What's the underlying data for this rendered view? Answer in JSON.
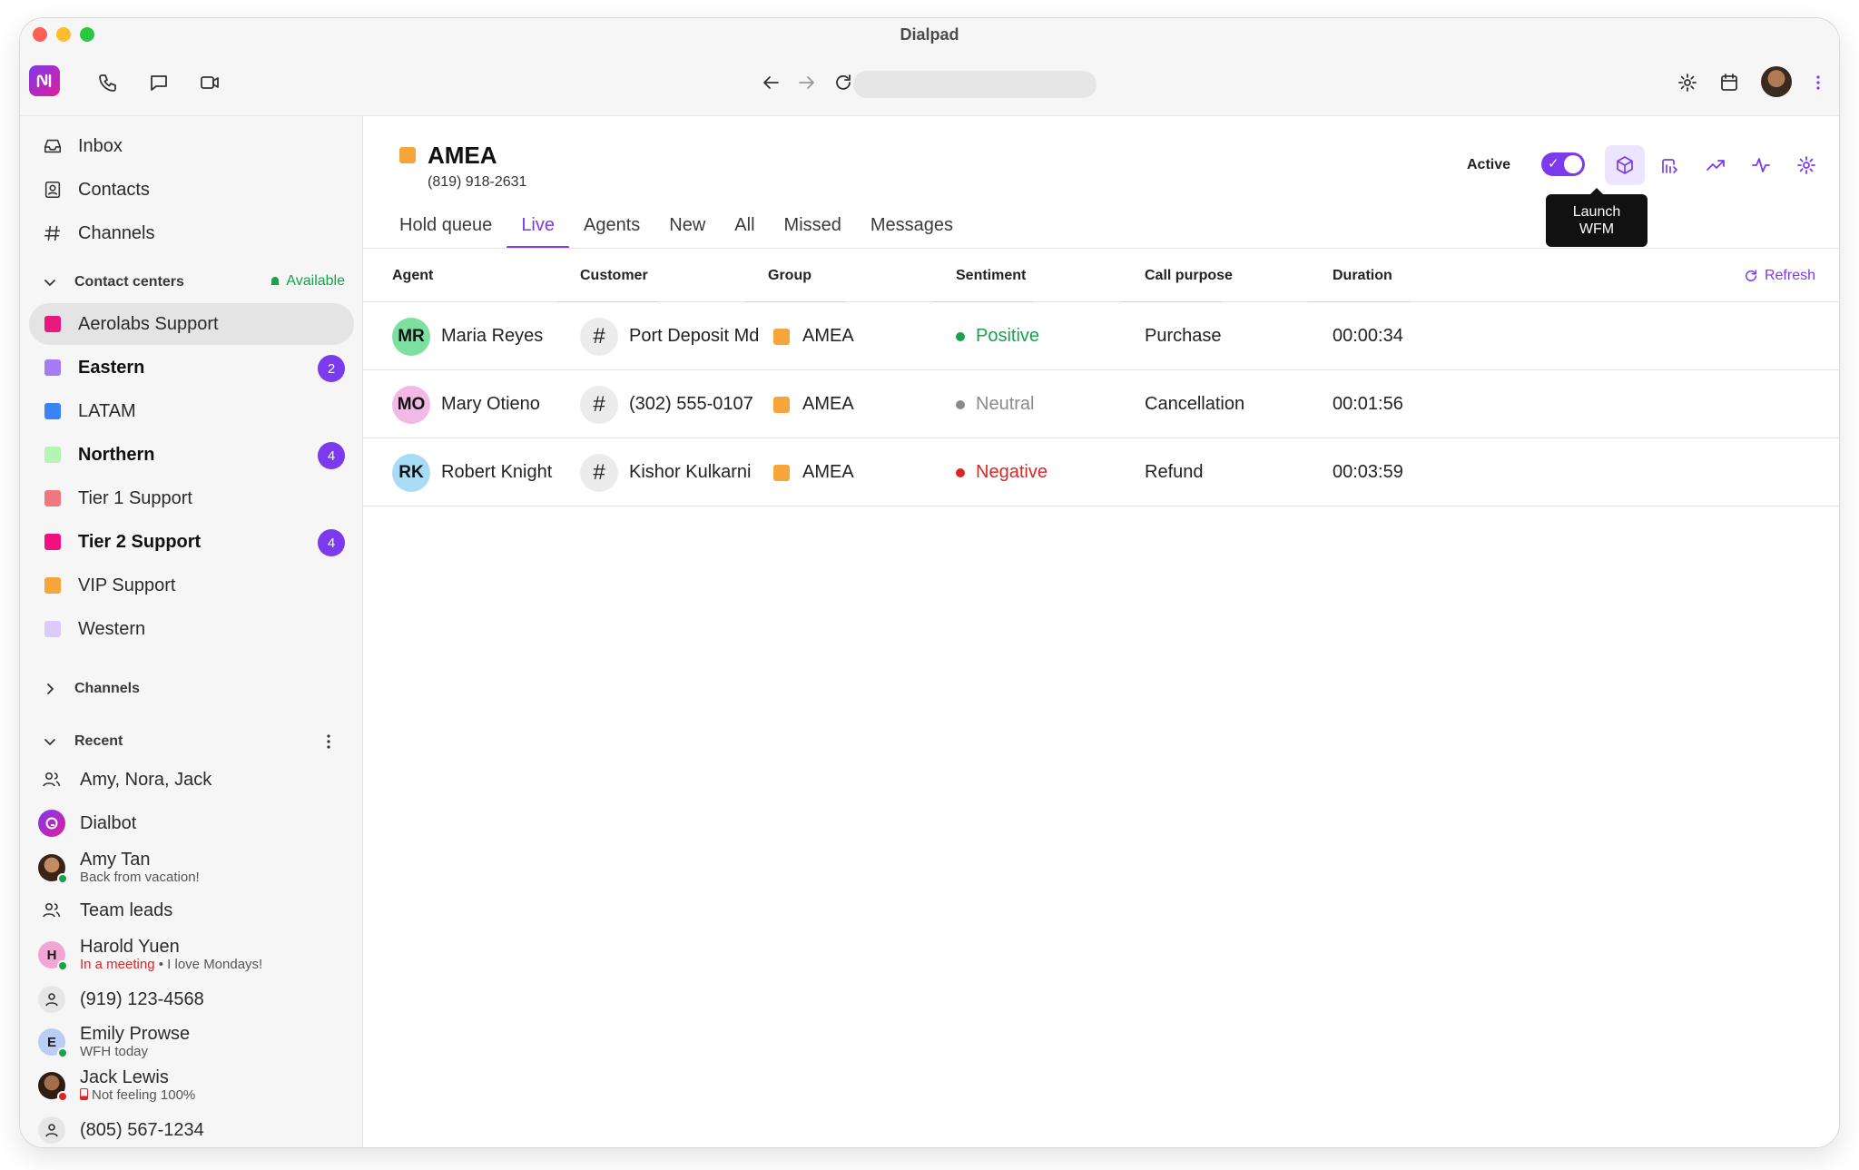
{
  "window": {
    "title": "Dialpad"
  },
  "sidebar": {
    "nav": [
      {
        "label": "Inbox",
        "icon": "inbox-icon"
      },
      {
        "label": "Contacts",
        "icon": "contacts-icon"
      },
      {
        "label": "Channels",
        "icon": "hash-icon"
      }
    ],
    "contact_centers": {
      "heading": "Contact centers",
      "status": "Available",
      "items": [
        {
          "label": "Aerolabs Support",
          "color": "#e8197d",
          "bold": false,
          "active": true,
          "count": ""
        },
        {
          "label": "Eastern",
          "color": "#a67cf5",
          "bold": true,
          "active": false,
          "count": "2"
        },
        {
          "label": "LATAM",
          "color": "#3b82f6",
          "bold": false,
          "active": false,
          "count": ""
        },
        {
          "label": "Northern",
          "color": "#b4f5b4",
          "bold": true,
          "active": false,
          "count": "4"
        },
        {
          "label": "Tier 1 Support",
          "color": "#f0787c",
          "bold": false,
          "active": false,
          "count": ""
        },
        {
          "label": "Tier 2 Support",
          "color": "#f2107f",
          "bold": true,
          "active": false,
          "count": "4"
        },
        {
          "label": "VIP Support",
          "color": "#f5a53a",
          "bold": false,
          "active": false,
          "count": ""
        },
        {
          "label": "Western",
          "color": "#dccbfa",
          "bold": false,
          "active": false,
          "count": ""
        }
      ]
    },
    "channels_heading": "Channels",
    "recent": {
      "heading": "Recent",
      "items": [
        {
          "name": "Amy, Nora, Jack",
          "sub": ""
        },
        {
          "name": "Dialbot",
          "sub": ""
        },
        {
          "name": "Amy Tan",
          "sub": "Back from vacation!"
        },
        {
          "name": "Team leads",
          "sub": ""
        },
        {
          "name": "Harold Yuen",
          "sub_status": "In a meeting",
          "sub_sep": "•",
          "sub": "I love Mondays!",
          "initial": "H"
        },
        {
          "name": "(919) 123-4568",
          "sub": ""
        },
        {
          "name": "Emily Prowse",
          "sub": "WFH today",
          "initial": "E"
        },
        {
          "name": "Jack Lewis",
          "sub": "Not feeling 100%"
        },
        {
          "name": "(805) 567-1234",
          "sub": ""
        }
      ]
    }
  },
  "header": {
    "title": "AMEA",
    "phone": "(819) 918-2631",
    "color": "#f5a53a",
    "active_label": "Active",
    "toggle_on": true,
    "tooltip_line1": "Launch",
    "tooltip_line2": "WFM"
  },
  "tabs": [
    "Hold queue",
    "Live",
    "Agents",
    "New",
    "All",
    "Missed",
    "Messages"
  ],
  "active_tab": "Live",
  "table": {
    "columns": [
      "Agent",
      "Customer",
      "Group",
      "Sentiment",
      "Call purpose",
      "Duration"
    ],
    "refresh_label": "Refresh",
    "rows": [
      {
        "initials": "MR",
        "avatar_color": "#7ee0a0",
        "agent": "Maria Reyes",
        "customer": "Port Deposit Md",
        "group": "AMEA",
        "sentiment": "Positive",
        "sentiment_color": "#16a34a",
        "purpose": "Purchase",
        "duration": "00:00:34"
      },
      {
        "initials": "MO",
        "avatar_color": "#f2b8e6",
        "agent": "Mary Otieno",
        "customer": "(302) 555-0107",
        "group": "AMEA",
        "sentiment": "Neutral",
        "sentiment_color": "#8a8a8a",
        "purpose": "Cancellation",
        "duration": "00:01:56"
      },
      {
        "initials": "RK",
        "avatar_color": "#a8dcf5",
        "agent": "Robert Knight",
        "customer": "Kishor Kulkarni",
        "group": "AMEA",
        "sentiment": "Negative",
        "sentiment_color": "#dc2626",
        "purpose": "Refund",
        "duration": "00:03:59"
      }
    ]
  },
  "colors": {
    "accent": "#7c3aed",
    "positive": "#16a34a",
    "negative": "#dc2626"
  }
}
